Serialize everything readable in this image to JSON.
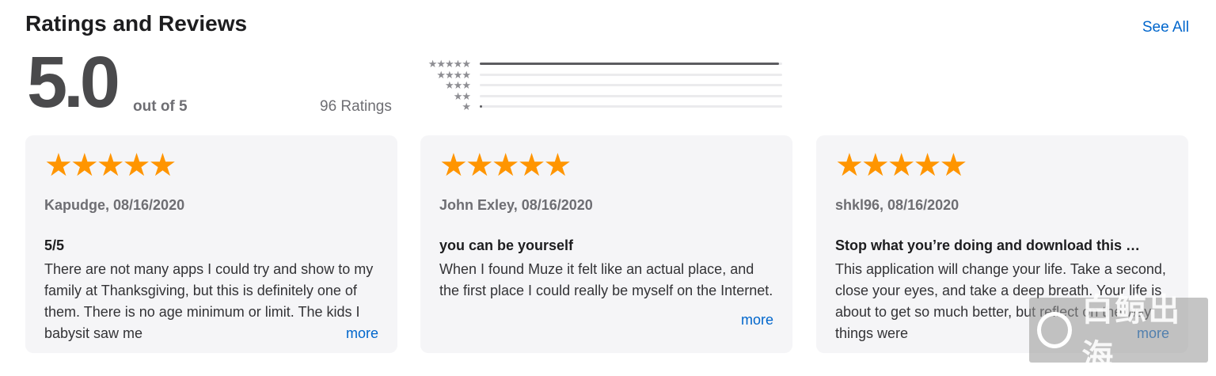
{
  "section": {
    "title": "Ratings and Reviews",
    "see_all": "See All"
  },
  "summary": {
    "score": "5.0",
    "out_of": "out of 5",
    "count": "96 Ratings"
  },
  "histogram": [
    {
      "stars": "★★★★★",
      "fraction": 0.99
    },
    {
      "stars": "★★★★",
      "fraction": 0.0
    },
    {
      "stars": "★★★",
      "fraction": 0.0
    },
    {
      "stars": "★★",
      "fraction": 0.0
    },
    {
      "stars": "★",
      "fraction": 0.01
    }
  ],
  "reviews": [
    {
      "stars": "★★★★★",
      "author_date": "Kapudge, 08/16/2020",
      "title": "5/5",
      "body": "There are not many apps I could try and show to my family at Thanksgiving, but this is definitely one of them. There is no age minimum or limit. The kids I babysit saw me",
      "more": "more"
    },
    {
      "stars": "★★★★★",
      "author_date": "John Exley, 08/16/2020",
      "title": "you can be yourself",
      "body": "When I found Muze it felt like an actual place, and the first place I could really be myself on the Internet.",
      "more": "more"
    },
    {
      "stars": "★★★★★",
      "author_date": "shkl96, 08/16/2020",
      "title": "Stop what you’re doing and download this …",
      "body": "This application will change your life. Take a second, close your eyes, and take a deep breath. Your life is about to get so much better, but reflect on the way things were",
      "more": "more"
    }
  ],
  "watermark": {
    "text": "白鲸出海"
  },
  "colors": {
    "accent": "#0066cc",
    "star": "#ff9500",
    "card_bg": "#f5f5f7"
  }
}
